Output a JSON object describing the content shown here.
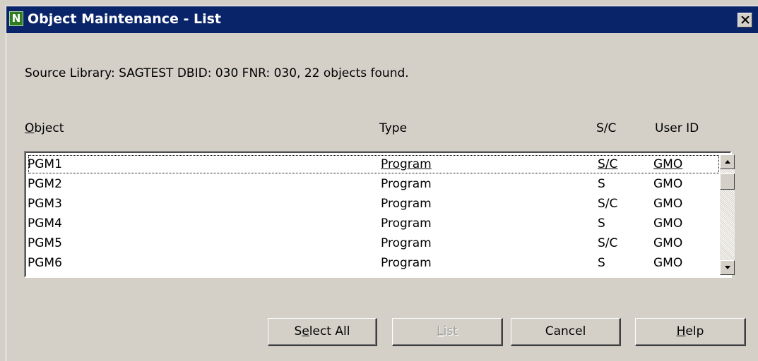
{
  "window": {
    "title": "Object Maintenance - List",
    "app_icon_letter": "N"
  },
  "info": {
    "text": "Source Library: SAGTEST  DBID: 030  FNR: 030, 22 objects found."
  },
  "columns": {
    "object": {
      "mnemonic": "O",
      "rest": "bject"
    },
    "type": "Type",
    "sc": "S/C",
    "user_id": "User ID"
  },
  "rows": [
    {
      "object": "PGM1",
      "type": "Program",
      "sc": "S/C",
      "user_id": "GMO"
    },
    {
      "object": "PGM2",
      "type": "Program",
      "sc": "S",
      "user_id": "GMO"
    },
    {
      "object": "PGM3",
      "type": "Program",
      "sc": "S/C",
      "user_id": "GMO"
    },
    {
      "object": "PGM4",
      "type": "Program",
      "sc": "S",
      "user_id": "GMO"
    },
    {
      "object": "PGM5",
      "type": "Program",
      "sc": "S/C",
      "user_id": "GMO"
    },
    {
      "object": "PGM6",
      "type": "Program",
      "sc": "S",
      "user_id": "GMO"
    }
  ],
  "buttons": {
    "select_all": {
      "pre": "S",
      "mnemonic": "e",
      "post": "lect All"
    },
    "list": {
      "pre": "",
      "mnemonic": "L",
      "post": "ist"
    },
    "cancel": "Cancel",
    "help": {
      "pre": "",
      "mnemonic": "H",
      "post": "elp"
    }
  },
  "icons": {
    "app": "natural-n-icon",
    "close": "close-icon",
    "scroll_up": "arrow-up-icon",
    "scroll_down": "arrow-down-icon"
  },
  "colors": {
    "titlebar": "#0a246a",
    "face": "#d4d0c8",
    "app_icon": "#2e7d1f"
  }
}
